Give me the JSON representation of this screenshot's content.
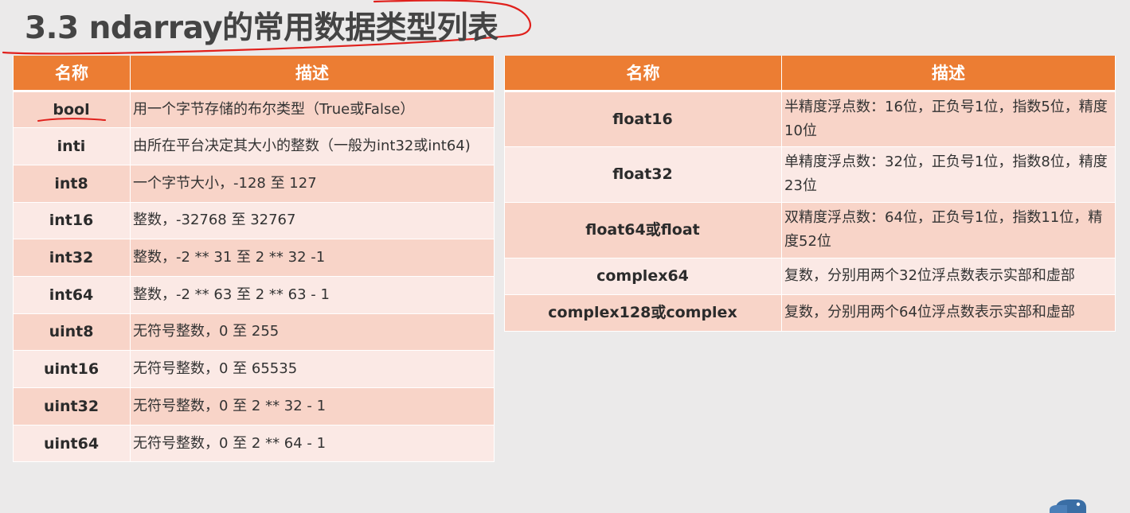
{
  "slide": {
    "title": "3.3 ndarray的常用数据类型列表"
  },
  "left_table": {
    "headers": [
      "名称",
      "描述"
    ],
    "rows": [
      {
        "name": "bool",
        "desc": "用一个字节存储的布尔类型（True或False）"
      },
      {
        "name": "inti",
        "desc": "由所在平台决定其大小的整数（一般为int32或int64)"
      },
      {
        "name": "int8",
        "desc": "一个字节大小，-128 至 127"
      },
      {
        "name": "int16",
        "desc": "整数，-32768 至 32767"
      },
      {
        "name": "int32",
        "desc": "整数，-2 ** 31 至 2 ** 32 -1"
      },
      {
        "name": "int64",
        "desc": "整数，-2 ** 63 至 2 ** 63 - 1"
      },
      {
        "name": "uint8",
        "desc": "无符号整数，0 至 255"
      },
      {
        "name": "uint16",
        "desc": "无符号整数，0 至 65535"
      },
      {
        "name": "uint32",
        "desc": "无符号整数，0 至 2 ** 32 - 1"
      },
      {
        "name": "uint64",
        "desc": "无符号整数，0 至 2 ** 64 - 1"
      }
    ]
  },
  "right_table": {
    "headers": [
      "名称",
      "描述"
    ],
    "rows": [
      {
        "name": "float16",
        "desc": "半精度浮点数：16位，正负号1位，指数5位，精度10位"
      },
      {
        "name": "float32",
        "desc": "单精度浮点数：32位，正负号1位，指数8位，精度23位"
      },
      {
        "name": "float64或float",
        "desc": "双精度浮点数：64位，正负号1位，指数11位，精度52位"
      },
      {
        "name": "complex64",
        "desc": "复数，分别用两个32位浮点数表示实部和虚部"
      },
      {
        "name": "complex128或complex",
        "desc": "复数，分别用两个64位浮点数表示实部和虚部"
      }
    ]
  },
  "colors": {
    "header_bg": "#ec7d33",
    "row_odd": "#f8d4c8",
    "row_even": "#fbe9e5",
    "annotation": "#e0201c"
  },
  "icons": [
    "python-logo-icon"
  ]
}
